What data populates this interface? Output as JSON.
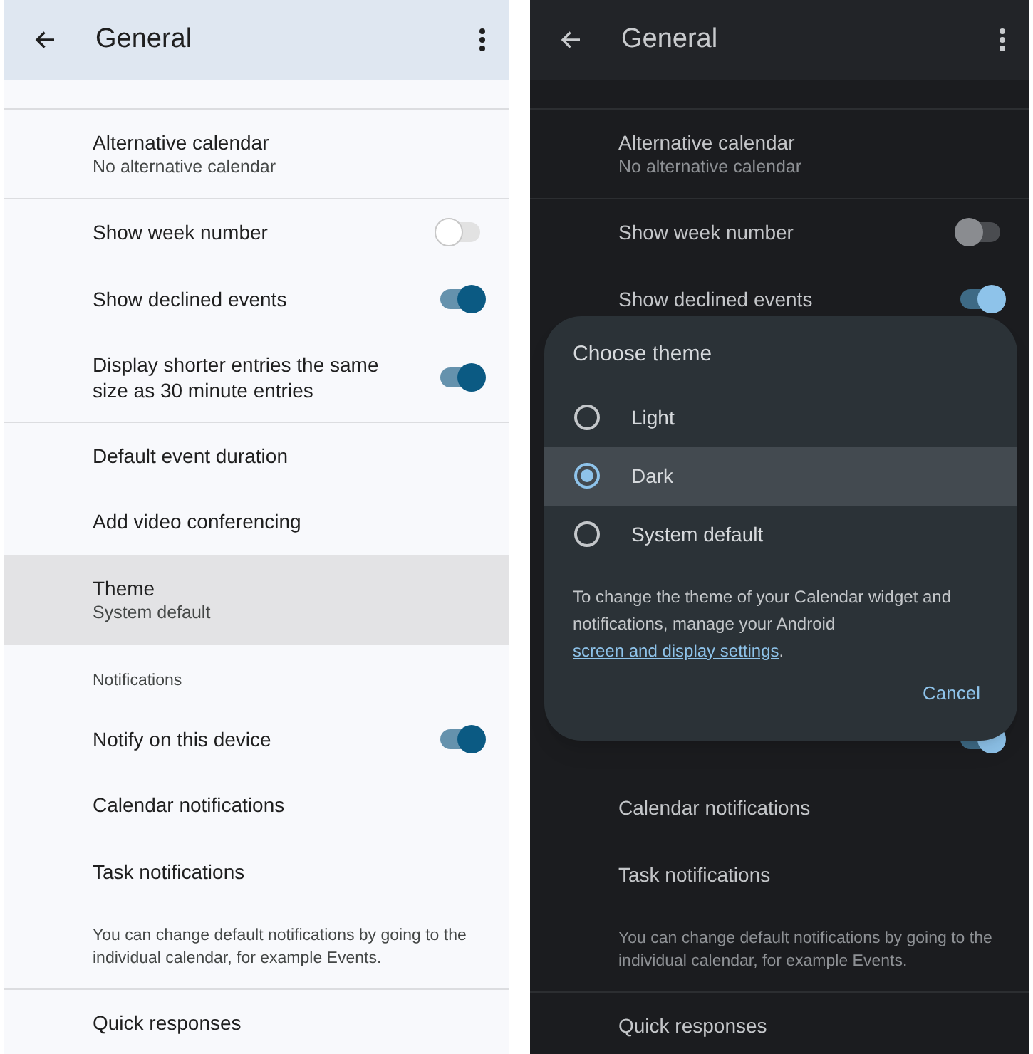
{
  "panels": [
    {
      "kind": "light",
      "title": "General",
      "rows": [
        {
          "kind": "two_line",
          "divider": true,
          "title": "Alternative calendar",
          "subtitle": "No alternative calendar",
          "selected": false
        },
        {
          "kind": "toggle",
          "divider": true,
          "label": "Show week number",
          "on": false
        },
        {
          "kind": "toggle",
          "divider": false,
          "label": "Show declined events",
          "on": true
        },
        {
          "kind": "toggle",
          "divider": false,
          "label": "Display shorter entries the same size as 30 minute entries",
          "on": true
        },
        {
          "kind": "single",
          "divider": true,
          "label": "Default event duration"
        },
        {
          "kind": "single",
          "divider": false,
          "label": "Add video conferencing"
        },
        {
          "kind": "two_line",
          "divider": false,
          "title": "Theme",
          "subtitle": "System default",
          "selected": true
        },
        {
          "kind": "section",
          "divider": false,
          "label": "Notifications"
        },
        {
          "kind": "toggle",
          "divider": false,
          "label": "Notify on this device",
          "on": true
        },
        {
          "kind": "single",
          "divider": false,
          "label": "Calendar notifications"
        },
        {
          "kind": "single",
          "divider": false,
          "label": "Task notifications"
        },
        {
          "kind": "note",
          "divider": false,
          "text": "You can change default notifications by going to the individual calendar, for example Events."
        },
        {
          "kind": "single",
          "divider": true,
          "label": "Quick responses"
        }
      ]
    },
    {
      "kind": "dark",
      "title": "General",
      "rows": [
        {
          "kind": "two_line",
          "divider": true,
          "title": "Alternative calendar",
          "subtitle": "No alternative calendar",
          "selected": false
        },
        {
          "kind": "toggle",
          "divider": true,
          "label": "Show week number",
          "on": false
        },
        {
          "kind": "toggle",
          "divider": false,
          "label": "Show declined events",
          "on": true
        },
        {
          "kind": "covered",
          "on": true
        },
        {
          "kind": "single",
          "divider": false,
          "label": "Calendar notifications"
        },
        {
          "kind": "single",
          "divider": false,
          "label": "Task notifications"
        },
        {
          "kind": "note",
          "divider": false,
          "text": "You can change default notifications by going to the individual calendar, for example Events."
        },
        {
          "kind": "single",
          "divider": true,
          "label": "Quick responses"
        }
      ],
      "dialog": {
        "title": "Choose theme",
        "options": [
          {
            "label": "Light",
            "selected": false
          },
          {
            "label": "Dark",
            "selected": true
          },
          {
            "label": "System default",
            "selected": false
          }
        ],
        "text_before": "To change the theme of your Calendar widget and notifications, manage your Android",
        "link": "screen and display settings",
        "text_after": ".",
        "button": "Cancel"
      }
    }
  ]
}
